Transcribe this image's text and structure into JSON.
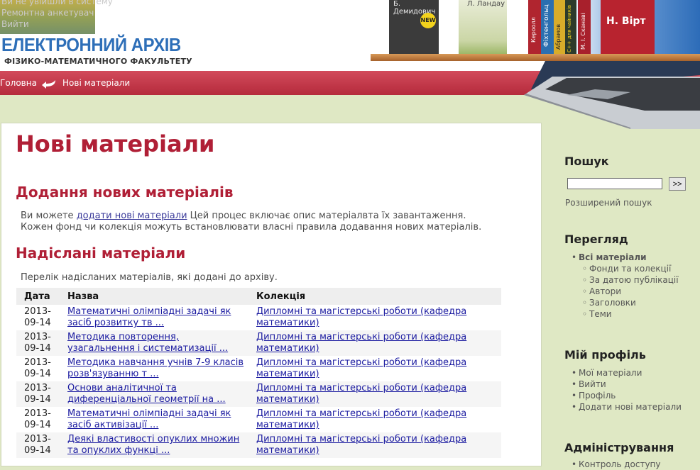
{
  "login": {
    "line1": "Ви не увійшли в систему",
    "line2": "Ремонтна анкетувач",
    "line3": "Вийти"
  },
  "logo": {
    "title": "ЕЛЕКТРОННИЙ АРХІВ",
    "subtitle": "ФІЗИКО-МАТЕМАТИЧНОГО ФАКУЛЬТЕТУ"
  },
  "books": {
    "b1": "Б. Демидович",
    "b1_badge": "NEW",
    "b2": "Л. Ландау",
    "b3": "Кероолл",
    "b4": "Фіхтенгольц",
    "b5": "Абрамов",
    "b6": "С++ для чайників",
    "b7": "М. І. Сканаві",
    "b8": "Н. Вірт"
  },
  "breadcrumb": {
    "home": "Головна",
    "current": "Нові матеріали"
  },
  "main": {
    "title": "Нові матеріали",
    "add_heading": "Додання нових матеріалів",
    "add_text_before": "Ви можете ",
    "add_link": "додати нові матеріали",
    "add_text_after": " Цей процес включає опис матеріалвта їх завантаження. Кожен фонд чи колекція можуть встановлювати власні правила додавання нових матеріалів.",
    "sent_heading": "Надіслані матеріали",
    "sent_text": "Перелік надісланих матеріалів, які додані до архіву."
  },
  "table": {
    "headers": [
      "Дата",
      "Назва",
      "Колекція"
    ],
    "rows": [
      {
        "date": "2013-09-14",
        "title": "Математичні олімпіадні задачі як засіб розвитку тв ...",
        "collection": "Дипломні та магістерські роботи (кафедра математики)"
      },
      {
        "date": "2013-09-14",
        "title": "Методика повторення, узагальнення і систематизації ...",
        "collection": "Дипломні та магістерські роботи (кафедра математики)"
      },
      {
        "date": "2013-09-14",
        "title": "Методика навчання учнів 7-9 класів розв'язуванню т ...",
        "collection": "Дипломні та магістерські роботи (кафедра математики)"
      },
      {
        "date": "2013-09-14",
        "title": "Основи аналітичної та диференціальної геометрії на ...",
        "collection": "Дипломні та магістерські роботи (кафедра математики)"
      },
      {
        "date": "2013-09-14",
        "title": "Математичні олімпіадні задачі як засіб активізації ...",
        "collection": "Дипломні та магістерські роботи (кафедра математики)"
      },
      {
        "date": "2013-09-14",
        "title": "Деякі властивості опуклих множин та опуклих функці ...",
        "collection": "Дипломні та магістерські роботи (кафедра математики)"
      }
    ]
  },
  "sidebar": {
    "search_heading": "Пошук",
    "search_button": ">>",
    "search_value": "",
    "advanced": "Розширений пошук",
    "browse_heading": "Перегляд",
    "browse_all": "Всі матеріали",
    "browse_items": [
      "Фонди та колекції",
      "За датою публікації",
      "Автори",
      "Заголовки",
      "Теми"
    ],
    "profile_heading": "Мій профіль",
    "profile_items": [
      "Мої матеріали",
      "Вийти",
      "Профіль",
      "Додати нові матеріали"
    ],
    "admin_heading": "Адміністрування",
    "admin_item": "Контроль доступу"
  }
}
